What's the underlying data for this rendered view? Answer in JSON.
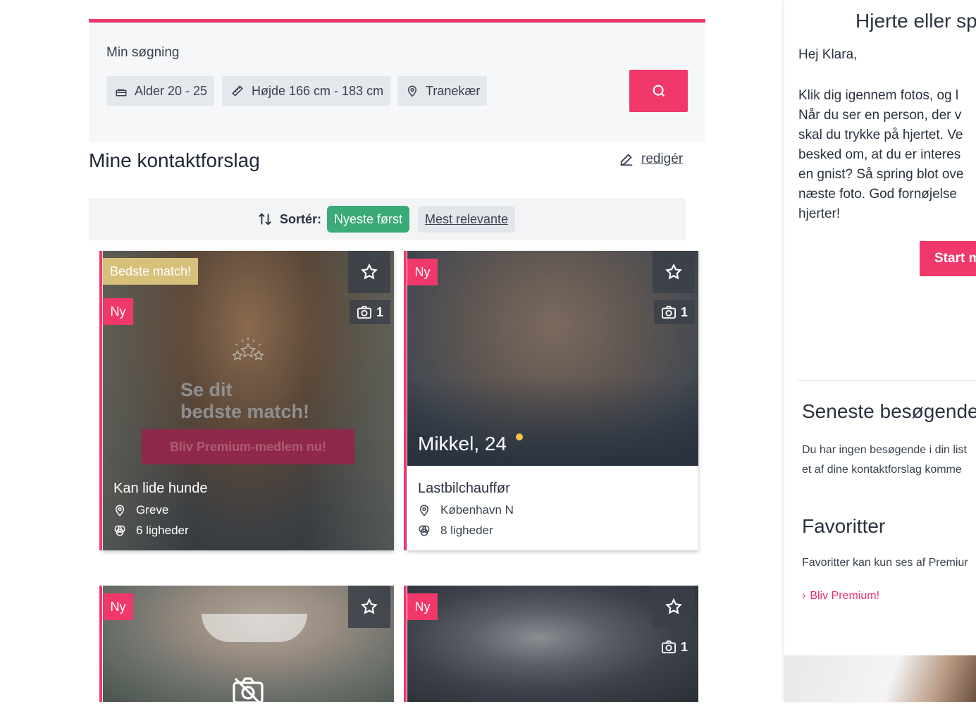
{
  "search": {
    "title": "Min søgning",
    "chips": [
      {
        "icon": "cake-icon",
        "label": "Alder 20 - 25"
      },
      {
        "icon": "ruler-icon",
        "label": "Højde 166 cm - 183 cm"
      },
      {
        "icon": "location-pin-icon",
        "label": "Tranekær"
      }
    ],
    "button_icon": "search-icon"
  },
  "suggestions": {
    "title": "Mine kontaktforslag",
    "edit_label": "redigér"
  },
  "sort": {
    "label": "Sortér:",
    "options": [
      {
        "label": "Nyeste først",
        "active": true
      },
      {
        "label": "Mest relevante",
        "active": false
      }
    ]
  },
  "cards": [
    {
      "best_match_badge": "Bedste match!",
      "new_badge": "Ny",
      "photo_count": "1",
      "overlay_title": "Se dit\nbedste match!",
      "overlay_button": "Bliv Premium-medlem nu!",
      "headline": "Kan lide hunde",
      "location": "Greve",
      "similarities": "6 ligheder"
    },
    {
      "new_badge": "Ny",
      "photo_count": "1",
      "name_age": "Mikkel, 24",
      "online_color": "#f5c242",
      "headline": "Lastbilchauffør",
      "location": "København N",
      "similarities": "8 ligheder"
    },
    {
      "new_badge": "Ny"
    },
    {
      "new_badge": "Ny",
      "photo_count": "1"
    }
  ],
  "sidebar": {
    "promo_title": "Hjerte eller sp",
    "greeting": "Hej Klara,",
    "body": "Klik dig igennem fotos, og l\nNår du ser en person, der v\nskal du trykke på hjertet. Ve\nbesked om, at du er interes\nen gnist? Så spring blot ove\nnæste foto. God fornøjelse\nhjerter!",
    "start_label": "Start m",
    "visitors_title": "Seneste besøgende",
    "visitors_text": "Du har ingen besøgende i din list\net af dine kontaktforslag komme",
    "favorites_title": "Favoritter",
    "favorites_text": "Favoritter kan kun ses af Premiur",
    "premium_link": "Bliv Premium!"
  },
  "colors": {
    "accent": "#f0386b",
    "sort_active": "#3aaa76",
    "best_match": "#d7c07a"
  }
}
